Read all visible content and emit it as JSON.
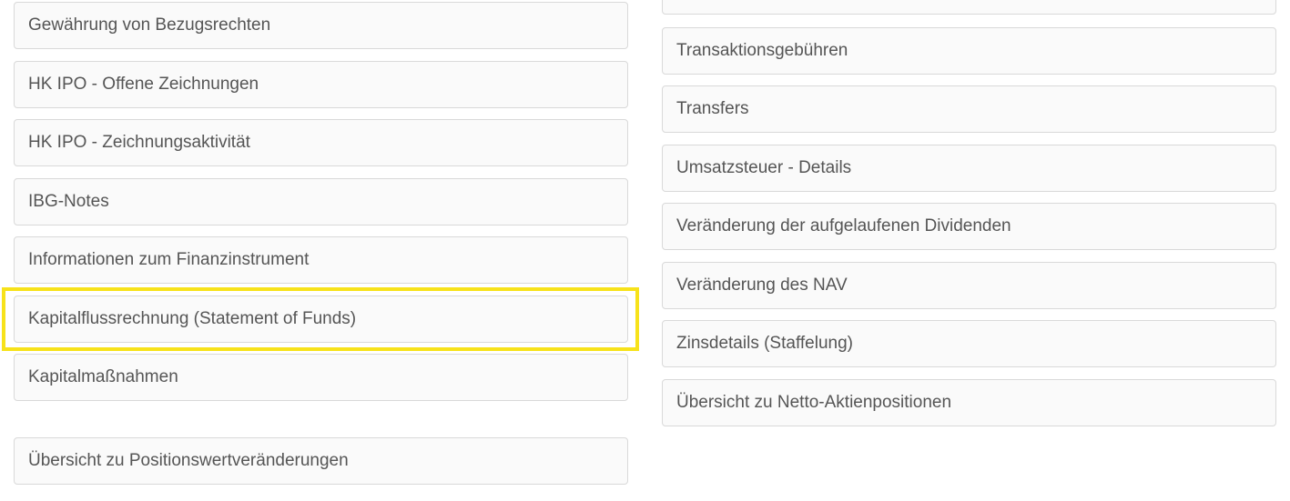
{
  "left_column": {
    "items": [
      {
        "label": "Gewährung von Bezugsrechten"
      },
      {
        "label": "HK IPO - Offene Zeichnungen"
      },
      {
        "label": "HK IPO - Zeichnungsaktivität"
      },
      {
        "label": "IBG-Notes"
      },
      {
        "label": "Informationen zum Finanzinstrument"
      },
      {
        "label": "Kapitalflussrechnung (Statement of Funds)"
      },
      {
        "label": "Kapitalmaßnahmen"
      },
      {
        "label": "Übersicht zu Positionswertveränderungen"
      }
    ]
  },
  "right_column": {
    "items": [
      {
        "label": ""
      },
      {
        "label": "Transaktionsgebühren"
      },
      {
        "label": "Transfers"
      },
      {
        "label": "Umsatzsteuer - Details"
      },
      {
        "label": "Veränderung der aufgelaufenen Dividenden"
      },
      {
        "label": "Veränderung des NAV"
      },
      {
        "label": "Zinsdetails (Staffelung)"
      },
      {
        "label": "Übersicht zu Netto-Aktienpositionen"
      }
    ]
  },
  "highlight": {
    "target": "Kapitalflussrechnung (Statement of Funds)",
    "color": "#f7e21a"
  },
  "colors": {
    "item_background": "#fafafa",
    "item_border": "#d9d9d9",
    "item_text": "#555555"
  }
}
